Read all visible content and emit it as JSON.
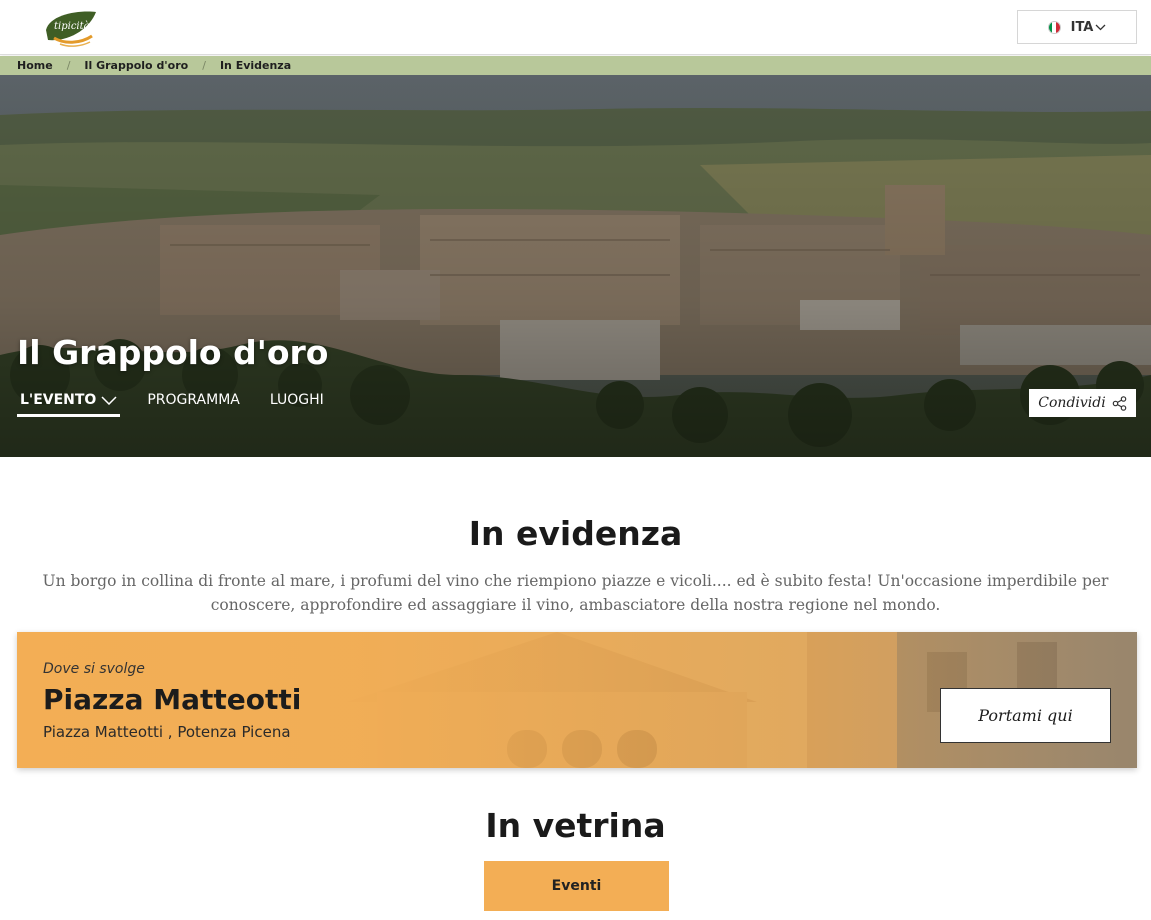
{
  "header": {
    "logo_text": "tipicità",
    "language": {
      "label": "ITA",
      "flag_colors": [
        "#009246",
        "#ffffff",
        "#ce2b37"
      ]
    }
  },
  "breadcrumb": {
    "items": [
      "Home",
      "Il Grappolo d'oro"
    ],
    "current": "In Evidenza",
    "separator": "/"
  },
  "hero": {
    "title": "Il Grappolo d'oro",
    "tabs": [
      {
        "label": "L'EVENTO",
        "active": true
      },
      {
        "label": "PROGRAMMA",
        "active": false
      },
      {
        "label": "LUOGHI",
        "active": false
      }
    ],
    "share_label": "Condividi"
  },
  "in_evidenza": {
    "title": "In evidenza",
    "text": "Un borgo in collina di fronte al mare, i profumi del vino che riempiono piazze e vicoli.... ed è subito festa! Un'occasione imperdibile per conoscere, approfondire ed assaggiare il vino, ambasciatore della nostra regione nel mondo."
  },
  "venue": {
    "kicker": "Dove si svolge",
    "name": "Piazza Matteotti",
    "address": "Piazza Matteotti , Potenza Picena",
    "button_label": "Portami qui"
  },
  "in_vetrina": {
    "title": "In vetrina",
    "button_label": "Eventi"
  },
  "colors": {
    "accent": "#f3ae55",
    "breadcrumb_bg": "#b8c89a",
    "logo_green": "#4a6b2a"
  }
}
